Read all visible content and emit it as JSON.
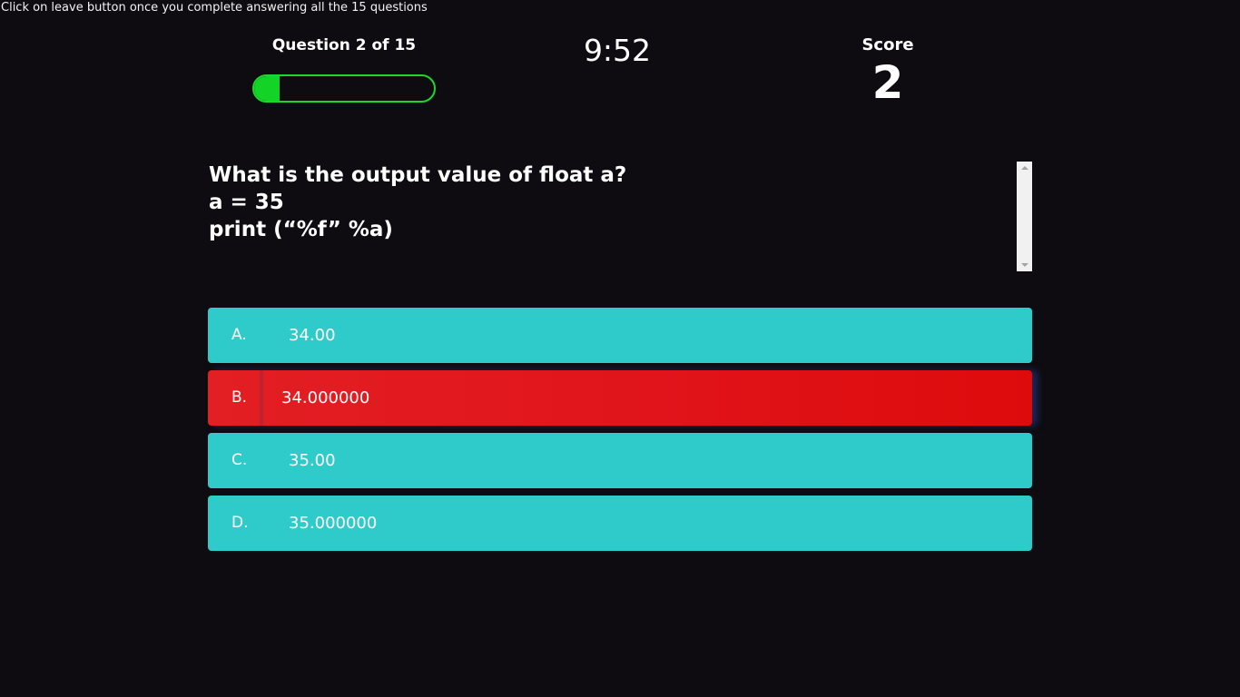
{
  "notice": "Click on leave button once you complete answering all the 15 questions",
  "progress": {
    "title": "Question 2 of 15",
    "fill_percent": 14
  },
  "timer": "9:52",
  "score": {
    "label": "Score",
    "value": "2"
  },
  "question": {
    "text": "What is the output value of float a?\na = 35\nprint (“%f” %a)"
  },
  "options": [
    {
      "letter": "A.",
      "text": "34.00",
      "selected": false
    },
    {
      "letter": "B.",
      "text": "34.000000",
      "selected": true
    },
    {
      "letter": "C.",
      "text": "35.00",
      "selected": false
    },
    {
      "letter": "D.",
      "text": "35.000000",
      "selected": false
    }
  ],
  "colors": {
    "background": "#0e0c10",
    "option": "#2fcbcb",
    "selected_option": "#e0141a",
    "progress": "#13d426"
  }
}
